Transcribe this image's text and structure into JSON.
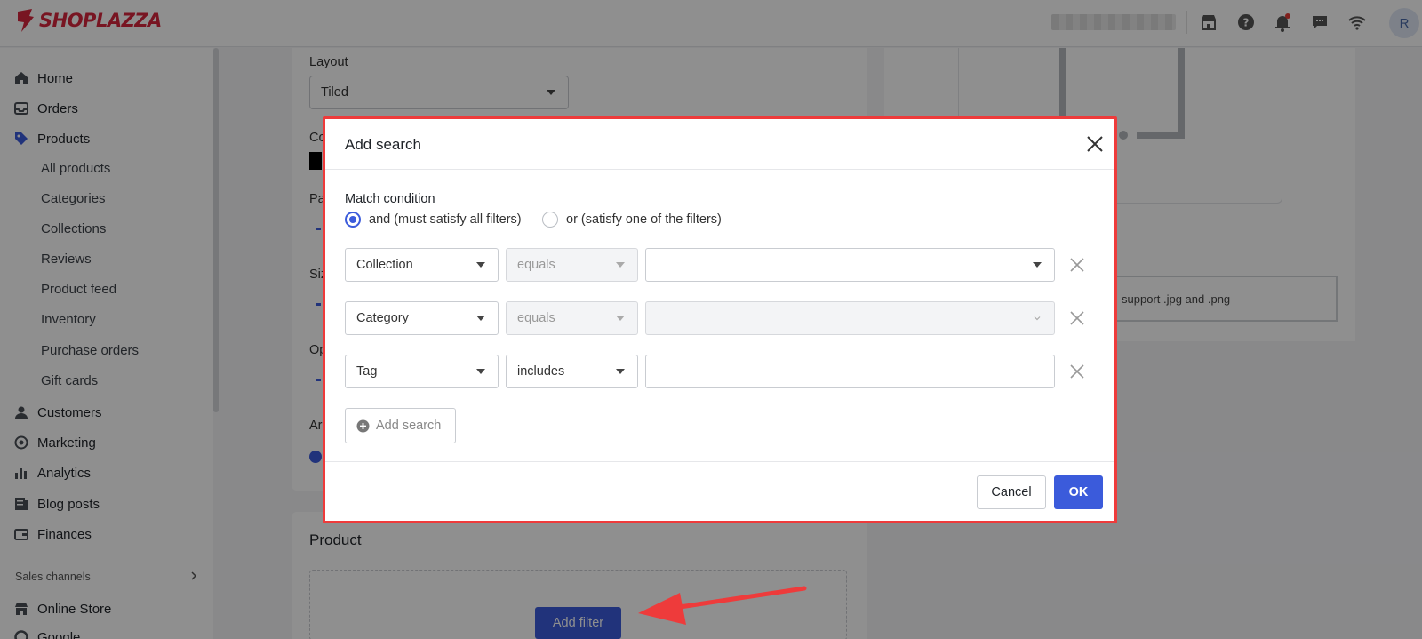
{
  "topbar": {
    "brand": "SHOPLAZZA",
    "avatar_initial": "R",
    "icons": [
      "store-icon",
      "help-icon",
      "bell-icon",
      "chat-icon",
      "wifi-icon"
    ]
  },
  "sidebar": {
    "items": [
      {
        "label": "Home",
        "icon": "home-icon"
      },
      {
        "label": "Orders",
        "icon": "inbox-icon"
      },
      {
        "label": "Products",
        "icon": "tag-icon"
      },
      {
        "label": "Customers",
        "icon": "person-icon"
      },
      {
        "label": "Marketing",
        "icon": "target-icon"
      },
      {
        "label": "Analytics",
        "icon": "bar-chart-icon"
      },
      {
        "label": "Blog posts",
        "icon": "blog-icon"
      },
      {
        "label": "Finances",
        "icon": "finance-icon"
      }
    ],
    "product_subitems": [
      "All products",
      "Categories",
      "Collections",
      "Reviews",
      "Product feed",
      "Inventory",
      "Purchase orders",
      "Gift cards"
    ],
    "section_label": "Sales channels",
    "channels": [
      {
        "label": "Online Store",
        "icon": "store-icon"
      },
      {
        "label": "Google",
        "icon": "google-icon"
      }
    ]
  },
  "main": {
    "layout_label": "Layout",
    "layout_value": "Tiled",
    "partial_labels": [
      "Co",
      "Pa",
      "Siz",
      "Op",
      "Ar"
    ],
    "product_title": "Product",
    "add_filter_label": "Add filter",
    "upload_hint": "support .jpg and .png"
  },
  "modal": {
    "title": "Add search",
    "match_condition_label": "Match condition",
    "radio_and": "and (must satisfy all filters)",
    "radio_or": "or (satisfy one of the filters)",
    "radio_selected": "and",
    "rows": [
      {
        "field": "Collection",
        "operator": "equals",
        "operator_disabled": true,
        "value": "",
        "value_type": "select"
      },
      {
        "field": "Category",
        "operator": "equals",
        "operator_disabled": true,
        "value": "",
        "value_type": "select-disabled"
      },
      {
        "field": "Tag",
        "operator": "includes",
        "operator_disabled": false,
        "value": "",
        "value_type": "text"
      }
    ],
    "add_search_label": "Add search",
    "cancel_label": "Cancel",
    "ok_label": "OK"
  },
  "colors": {
    "primary": "#3b5bdb",
    "brand": "#d7263d",
    "modal_highlight": "#ee3b3b",
    "annotation_arrow": "#ee3b3b"
  }
}
